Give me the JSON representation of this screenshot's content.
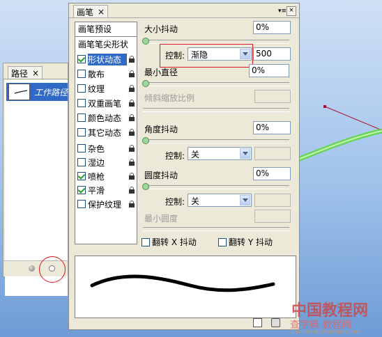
{
  "paths_panel": {
    "tab_label": "路径",
    "close": "×",
    "items": [
      {
        "label": "工作路径"
      }
    ]
  },
  "brush_panel": {
    "tab_label": "画笔",
    "close": "×",
    "menu": "▾≡",
    "window_close": "×",
    "sidebar": {
      "header": "画笔预设",
      "sub": "画笔笔尖形状",
      "items": [
        {
          "label": "形状动态",
          "checked": true,
          "selected": true
        },
        {
          "label": "散布",
          "checked": false
        },
        {
          "label": "纹理",
          "checked": false
        },
        {
          "label": "双重画笔",
          "checked": false
        },
        {
          "label": "颜色动态",
          "checked": false
        },
        {
          "label": "其它动态",
          "checked": false
        },
        {
          "label": "杂色",
          "checked": false
        },
        {
          "label": "湿边",
          "checked": false
        },
        {
          "label": "喷枪",
          "checked": true
        },
        {
          "label": "平滑",
          "checked": true
        },
        {
          "label": "保护纹理",
          "checked": false
        }
      ]
    },
    "size_jitter": {
      "label": "大小抖动",
      "value": "0%",
      "control_label": "控制:",
      "control_value": "渐隐",
      "fade_steps": "500"
    },
    "min_diameter": {
      "label": "最小直径",
      "value": "0%"
    },
    "tilt_scale": {
      "label": "倾斜缩放比例"
    },
    "angle_jitter": {
      "label": "角度抖动",
      "value": "0%",
      "control_label": "控制:",
      "control_value": "关"
    },
    "roundness_jitter": {
      "label": "圆度抖动",
      "value": "0%",
      "control_label": "控制:",
      "control_value": "关"
    },
    "min_roundness": {
      "label": "最小圆度"
    },
    "flip_x": {
      "label": "翻转 X 抖动",
      "checked": false
    },
    "flip_y": {
      "label": "翻转 Y 抖动",
      "checked": false
    }
  },
  "watermark": {
    "line1": "中国教程网",
    "line2": "查字典 教程网",
    "line3": "jiaocheng.chazidian.com"
  },
  "colors": {
    "selection": "#3169c6",
    "highlight_red": "#d8141c",
    "panel_bg": "#ece9d8"
  }
}
